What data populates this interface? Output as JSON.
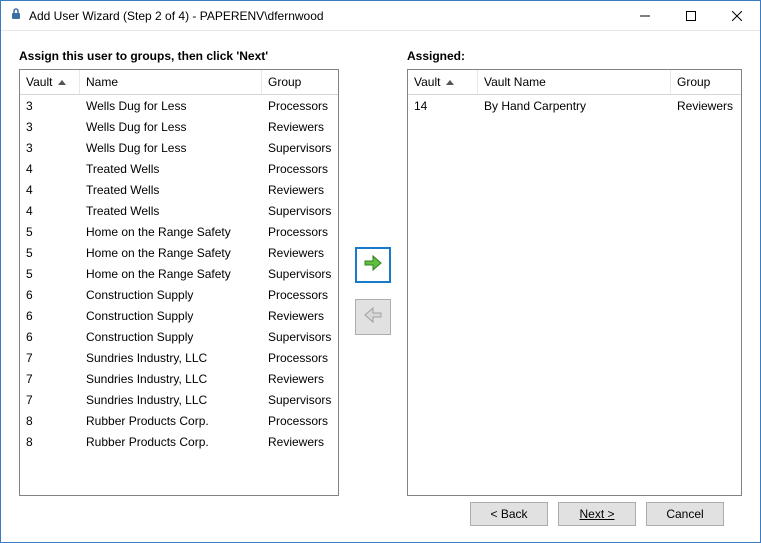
{
  "window": {
    "title": "Add User Wizard (Step 2 of 4) - PAPERENV\\dfernwood"
  },
  "left": {
    "label": "Assign this user to groups, then click 'Next'",
    "headers": [
      "Vault",
      "Name",
      "Group"
    ],
    "rows": [
      {
        "vault": "3",
        "name": "Wells Dug for Less",
        "group": "Processors"
      },
      {
        "vault": "3",
        "name": "Wells Dug for Less",
        "group": "Reviewers"
      },
      {
        "vault": "3",
        "name": "Wells Dug for Less",
        "group": "Supervisors"
      },
      {
        "vault": "4",
        "name": "Treated Wells",
        "group": "Processors"
      },
      {
        "vault": "4",
        "name": "Treated Wells",
        "group": "Reviewers"
      },
      {
        "vault": "4",
        "name": "Treated Wells",
        "group": "Supervisors"
      },
      {
        "vault": "5",
        "name": "Home on the Range Safety",
        "group": "Processors"
      },
      {
        "vault": "5",
        "name": "Home on the Range Safety",
        "group": "Reviewers"
      },
      {
        "vault": "5",
        "name": "Home on the Range Safety",
        "group": "Supervisors"
      },
      {
        "vault": "6",
        "name": "Construction Supply",
        "group": "Processors"
      },
      {
        "vault": "6",
        "name": "Construction Supply",
        "group": "Reviewers"
      },
      {
        "vault": "6",
        "name": "Construction Supply",
        "group": "Supervisors"
      },
      {
        "vault": "7",
        "name": "Sundries Industry, LLC",
        "group": "Processors"
      },
      {
        "vault": "7",
        "name": "Sundries Industry, LLC",
        "group": "Reviewers"
      },
      {
        "vault": "7",
        "name": "Sundries Industry, LLC",
        "group": "Supervisors"
      },
      {
        "vault": "8",
        "name": "Rubber Products Corp.",
        "group": "Processors"
      },
      {
        "vault": "8",
        "name": "Rubber Products Corp.",
        "group": "Reviewers"
      }
    ]
  },
  "right": {
    "label": "Assigned:",
    "headers": [
      "Vault",
      "Vault Name",
      "Group"
    ],
    "rows": [
      {
        "vault": "14",
        "name": "By Hand Carpentry",
        "group": "Reviewers"
      }
    ]
  },
  "buttons": {
    "back": "< Back",
    "next": "Next >",
    "cancel": "Cancel"
  }
}
